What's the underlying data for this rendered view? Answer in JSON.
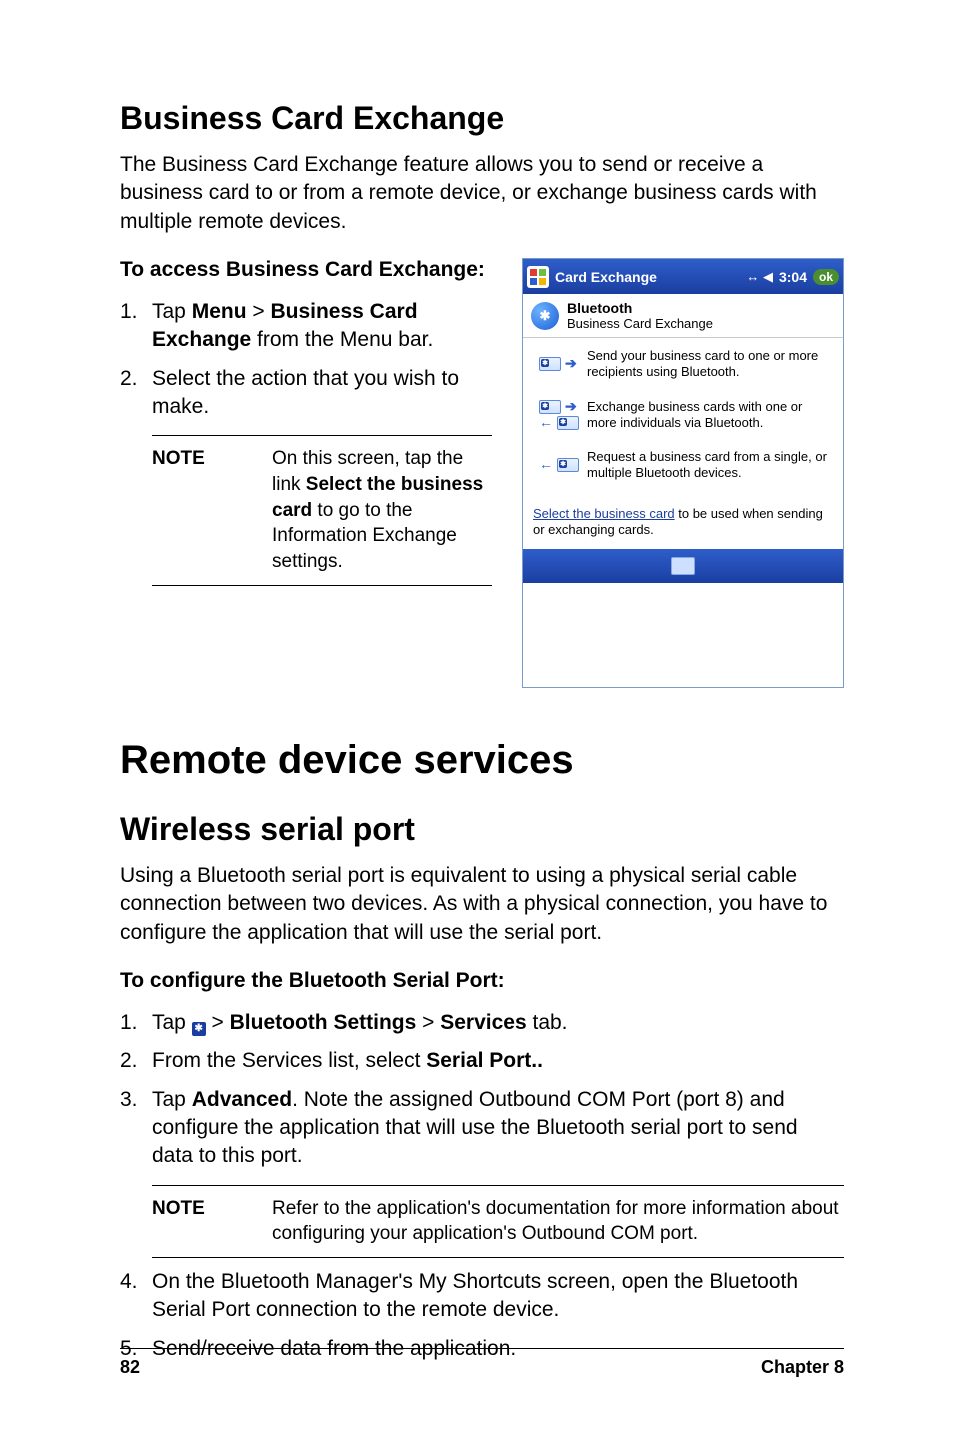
{
  "h2_bce": "Business Card Exchange",
  "p_bce_intro": "The Business Card Exchange feature allows you to send or receive a business card to or from a remote device, or exchange business cards with multiple remote devices.",
  "h3_bce_access": "To access Business Card Exchange:",
  "bce_steps": {
    "s1_a": "Tap ",
    "s1_b": "Menu",
    "s1_c": " > ",
    "s1_d": "Business Card Exchange",
    "s1_e": " from the Menu bar.",
    "s2": "Select the action that you wish to make."
  },
  "bce_note": {
    "label": "NOTE",
    "a": "On this screen, tap the link ",
    "b": "Select the business card",
    "c": " to go to the Information Exchange settings."
  },
  "h1_rds": "Remote device services",
  "h2_wsp": "Wireless serial port",
  "p_wsp_intro": "Using a Bluetooth serial port is equivalent to using a physical serial cable connection between two devices. As with a physical connection, you have to configure the application that will use the serial port.",
  "h3_wsp_conf": "To configure the Bluetooth Serial Port:",
  "wsp_steps": {
    "s1_a": "Tap ",
    "s1_b": " > ",
    "s1_c": "Bluetooth Settings",
    "s1_d": " > ",
    "s1_e": "Services",
    "s1_f": " tab.",
    "s2_a": "From the Services list, select ",
    "s2_b": "Serial Port..",
    "s3_a": "Tap ",
    "s3_b": "Advanced",
    "s3_c": ". Note the assigned Outbound COM Port  (port 8) and configure the application that will use the Bluetooth serial port to send data to this port.",
    "s4": "On the Bluetooth Manager's My Shortcuts screen, open the Bluetooth Serial Port connection to the remote device.",
    "s5": "Send/receive data from the application."
  },
  "wsp_note": {
    "label": "NOTE",
    "text": "Refer to the application's documentation for more information about configuring your application's Outbound COM port."
  },
  "footer": {
    "page": "82",
    "chapter": "Chapter 8"
  },
  "shot": {
    "title": "Card Exchange",
    "time": "3:04",
    "ok": "ok",
    "header_title": "Bluetooth",
    "header_sub": "Business Card Exchange",
    "items": [
      "Send your business card to one or more recipients using Bluetooth.",
      "Exchange business cards with one or more individuals via Bluetooth.",
      "Request a business card from a single, or multiple Bluetooth devices."
    ],
    "link": "Select the business card",
    "link_rest": " to be used when sending or exchanging cards.",
    "bt_glyph": "✱",
    "signal_glyph": "↔ ◀"
  }
}
